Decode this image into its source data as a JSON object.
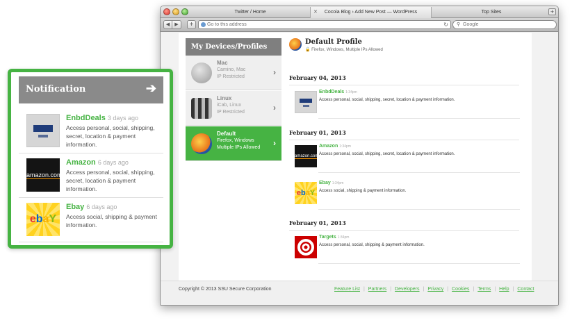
{
  "browser": {
    "tabs": [
      "Twitter / Home",
      "Cocoia Blog › Add New Post — WordPress",
      "Top Sites"
    ],
    "address_placeholder": "Go to this address",
    "search_placeholder": "Google"
  },
  "devices": {
    "heading": "My Devices/Profiles",
    "items": [
      {
        "name": "Mac",
        "line1": "Camino, Mac",
        "line2": "IP Restricted"
      },
      {
        "name": "Linux",
        "line1": "iCab, Linux",
        "line2": "IP Restricted"
      },
      {
        "name": "Default",
        "line1": "Firefox, Windows",
        "line2": "Multiple IPs Allowed"
      }
    ]
  },
  "profile": {
    "title": "Default Profile",
    "subtitle": "Firefox, Windows, Multiple IPs Allowed"
  },
  "feed": [
    {
      "date": "February 04, 2013",
      "entries": [
        {
          "name": "EnbdDeals",
          "time": "1:34pm",
          "desc": "Access personal, social, shipping, secret, location & payment information."
        }
      ]
    },
    {
      "date": "February 01, 2013",
      "entries": [
        {
          "name": "Amazon",
          "time": "1:34pm",
          "desc": "Access personal, social, shipping, secret, location & payment information."
        },
        {
          "name": "Ebay",
          "time": "1:34pm",
          "desc": "Access social, shipping & payment information."
        }
      ]
    },
    {
      "date": "February 01, 2013",
      "entries": [
        {
          "name": "Targets",
          "time": "1:34pm",
          "desc": "Access personal, social, shipping & payment information."
        }
      ]
    }
  ],
  "footer": {
    "copyright": "Copyright © 2013 SSU Secure Corporation",
    "links": [
      "Feature List",
      "Partners",
      "Developers",
      "Privacy",
      "Cookies",
      "Terms",
      "Help",
      "Contact"
    ]
  },
  "notification": {
    "title": "Notification",
    "items": [
      {
        "name": "EnbdDeals",
        "time": "3 days ago",
        "desc": "Access personal, social, shipping, secret, location & payment information."
      },
      {
        "name": "Amazon",
        "time": "6 days ago",
        "desc": "Access personal, social, shipping, secret, location & payment information."
      },
      {
        "name": "Ebay",
        "time": "6 days ago",
        "desc": "Access social, shipping & payment information."
      }
    ]
  },
  "logos": {
    "amazon": "amazon.com",
    "ebay": [
      "e",
      "b",
      "a",
      "Y"
    ]
  },
  "colors": {
    "accent": "#46b343",
    "header_gray": "#8a8a8a"
  }
}
